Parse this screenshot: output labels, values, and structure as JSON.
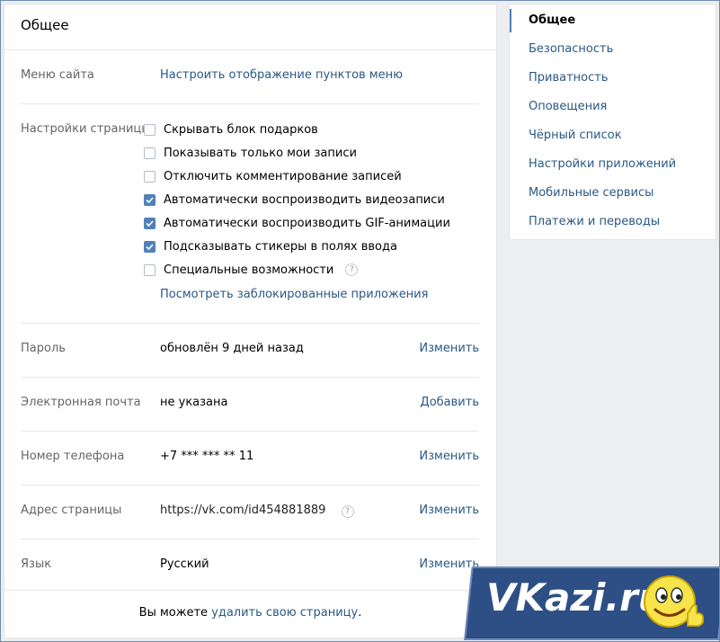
{
  "main": {
    "title": "Общее",
    "menu_site": {
      "label": "Меню сайта",
      "link": "Настроить отображение пунктов меню"
    },
    "page_settings": {
      "label": "Настройки страницы",
      "options": [
        {
          "label": "Скрывать блок подарков",
          "checked": false
        },
        {
          "label": "Показывать только мои записи",
          "checked": false
        },
        {
          "label": "Отключить комментирование записей",
          "checked": false
        },
        {
          "label": "Автоматически воспроизводить видеозаписи",
          "checked": true
        },
        {
          "label": "Автоматически воспроизводить GIF-анимации",
          "checked": true
        },
        {
          "label": "Подсказывать стикеры в полях ввода",
          "checked": true
        },
        {
          "label": "Специальные возможности",
          "checked": false
        }
      ],
      "help_glyph": "?",
      "blocked_apps_link": "Посмотреть заблокированные приложения"
    },
    "password": {
      "label": "Пароль",
      "value": "обновлён 9 дней назад",
      "action": "Изменить"
    },
    "email": {
      "label": "Электронная почта",
      "value": "не указана",
      "action": "Добавить"
    },
    "phone": {
      "label": "Номер телефона",
      "value": "+7 *** *** ** 11",
      "action": "Изменить"
    },
    "address": {
      "label": "Адрес страницы",
      "value": "https://vk.com/id454881889",
      "action": "Изменить"
    },
    "language": {
      "label": "Язык",
      "value": "Русский",
      "action": "Изменить"
    },
    "footer": {
      "prefix": "Вы можете ",
      "link": "удалить свою страницу",
      "suffix": "."
    }
  },
  "sidebar": {
    "items": [
      {
        "label": "Общее",
        "active": true
      },
      {
        "label": "Безопасность",
        "active": false
      },
      {
        "label": "Приватность",
        "active": false
      },
      {
        "label": "Оповещения",
        "active": false
      },
      {
        "label": "Чёрный список",
        "active": false
      },
      {
        "label": "Настройки приложений",
        "active": false
      },
      {
        "label": "Мобильные сервисы",
        "active": false
      },
      {
        "label": "Платежи и переводы",
        "active": false
      }
    ]
  },
  "watermark": {
    "text": "VKazi.ru"
  },
  "colors": {
    "link": "#2a5885",
    "accent": "#5181b8",
    "background": "#edeef0",
    "watermark": "#2d4f86"
  },
  "icons": {
    "checkbox": "check-icon",
    "help": "question-icon",
    "smiley": "smiley-thumbs-up-icon"
  }
}
